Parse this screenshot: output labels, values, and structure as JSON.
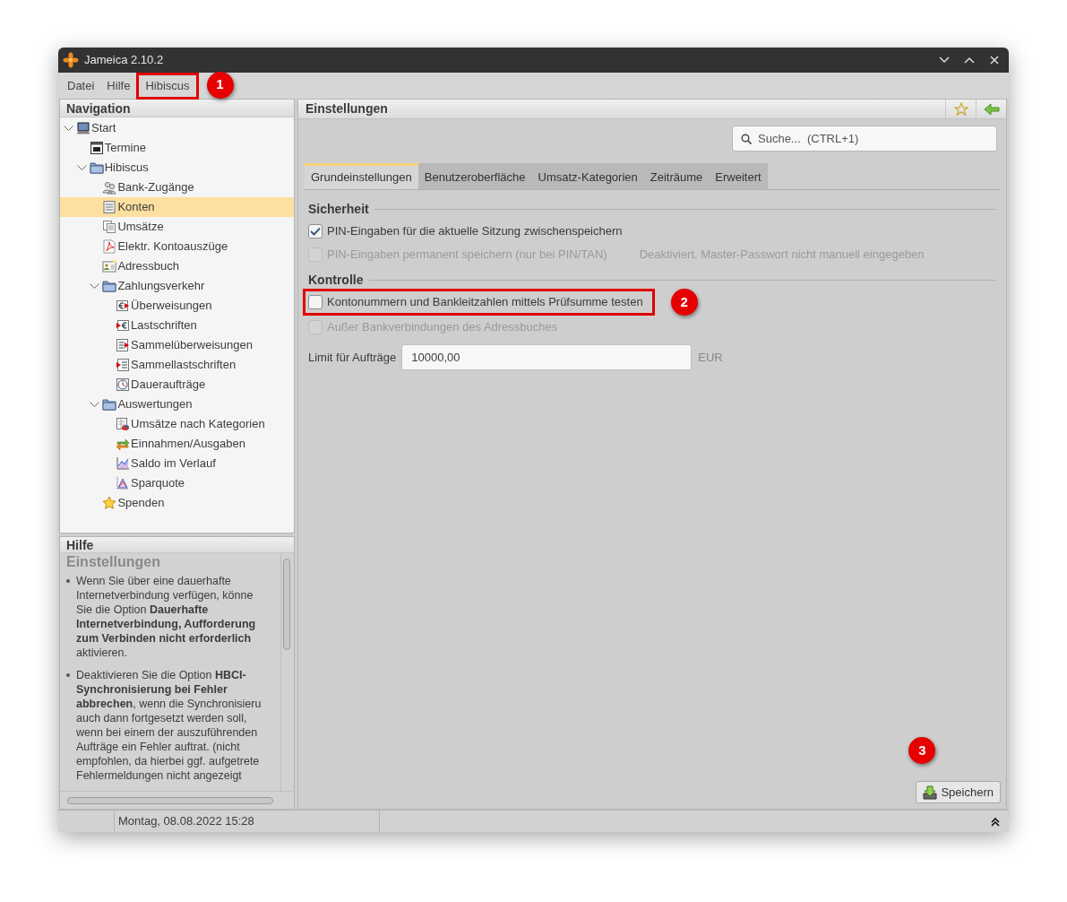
{
  "window": {
    "title": "Jameica 2.10.2"
  },
  "menu": [
    {
      "label": "Datei"
    },
    {
      "label": "Hilfe"
    },
    {
      "label": "Hibiscus",
      "annotation": {
        "label": "1",
        "boxed": true
      }
    }
  ],
  "navigation": {
    "title": "Navigation",
    "items": [
      {
        "label": "Start",
        "kind": "computer",
        "selected": false,
        "expanded": true,
        "children": [
          {
            "label": "Termine",
            "kind": "calendar",
            "selected": false
          },
          {
            "label": "Hibiscus",
            "kind": "folder",
            "selected": false,
            "expanded": true,
            "children": [
              {
                "label": "Bank-Zugänge",
                "kind": "people",
                "selected": false
              },
              {
                "label": "Konten",
                "kind": "ledger",
                "selected": true
              },
              {
                "label": "Umsätze",
                "kind": "pages",
                "selected": false
              },
              {
                "label": "Elektr. Kontoauszüge",
                "kind": "pdf",
                "selected": false
              },
              {
                "label": "Adressbuch",
                "kind": "card",
                "selected": false
              },
              {
                "label": "Zahlungsverkehr",
                "kind": "folder",
                "selected": false,
                "expanded": true,
                "children": [
                  {
                    "label": "Überweisungen",
                    "kind": "euro-out",
                    "selected": false
                  },
                  {
                    "label": "Lastschriften",
                    "kind": "euro-in",
                    "selected": false
                  },
                  {
                    "label": "Sammelüberweisungen",
                    "kind": "list-out",
                    "selected": false
                  },
                  {
                    "label": "Sammellastschriften",
                    "kind": "list-in",
                    "selected": false
                  },
                  {
                    "label": "Daueraufträge",
                    "kind": "clock",
                    "selected": false
                  }
                ]
              },
              {
                "label": "Auswertungen",
                "kind": "folder",
                "selected": false,
                "expanded": true,
                "children": [
                  {
                    "label": "Umsätze nach Kategorien",
                    "kind": "pie-table",
                    "selected": false
                  },
                  {
                    "label": "Einnahmen/Ausgaben",
                    "kind": "arrows",
                    "selected": false
                  },
                  {
                    "label": "Saldo im Verlauf",
                    "kind": "line-chart",
                    "selected": false
                  },
                  {
                    "label": "Sparquote",
                    "kind": "triangle-chart",
                    "selected": false
                  }
                ]
              },
              {
                "label": "Spenden",
                "kind": "star",
                "selected": false
              }
            ]
          }
        ]
      }
    ]
  },
  "help": {
    "title": "Hilfe",
    "heading": "Einstellungen",
    "bullets": [
      "Wenn Sie über eine dauerhafte\nInternetverbindung verfügen, könne\nSie die Option **Dauerhafte**\n**Internetverbindung, Aufforderung**\n**zum Verbinden nicht erforderlich**\naktivieren.",
      "Deaktivieren Sie die Option **HBCI-**\n**Synchronisierung bei Fehler**\n**abbrechen**, wenn die Synchronisieru\nauch dann fortgesetzt werden soll,\nwenn bei einem der auszuführenden\nAufträge ein Fehler auftrat. (nicht\nempfohlen, da hierbei ggf. aufgetrete\nFehlermeldungen nicht angezeigt"
    ]
  },
  "settings": {
    "title": "Einstellungen",
    "search": {
      "placeholder": "Suche...  (CTRL+1)"
    },
    "tabs": [
      {
        "label": "Grundeinstellungen",
        "selected": true
      },
      {
        "label": "Benutzeroberfläche",
        "selected": false
      },
      {
        "label": "Umsatz-Kategorien",
        "selected": false
      },
      {
        "label": "Zeiträume",
        "selected": false
      },
      {
        "label": "Erweitert",
        "selected": false
      }
    ],
    "sections": [
      {
        "title": "Sicherheit",
        "options": [
          {
            "label": "PIN-Eingaben für die aktuelle Sitzung zwischenspeichern",
            "checked": true,
            "disabled": false
          },
          {
            "label": "PIN-Eingaben permanent speichern (nur bei PIN/TAN)",
            "checked": false,
            "disabled": true,
            "hint": "Deaktiviert. Master-Passwort nicht manuell eingegeben"
          }
        ]
      },
      {
        "title": "Kontrolle",
        "options": [
          {
            "label": "Kontonummern und Bankleitzahlen mittels Prüfsumme testen",
            "checked": false,
            "disabled": false,
            "annotation": {
              "label": "2",
              "boxed": true
            }
          },
          {
            "label": "Außer Bankverbindungen des Adressbuches",
            "checked": false,
            "disabled": true
          }
        ]
      }
    ],
    "limit": {
      "label": "Limit für Aufträge",
      "value": "10000,00",
      "unit": "EUR"
    },
    "save_button": {
      "label": "Speichern",
      "annotation": {
        "label": "3",
        "boxed": false
      }
    }
  },
  "status_bar": {
    "date": "Montag, 08.08.2022 15:28"
  }
}
